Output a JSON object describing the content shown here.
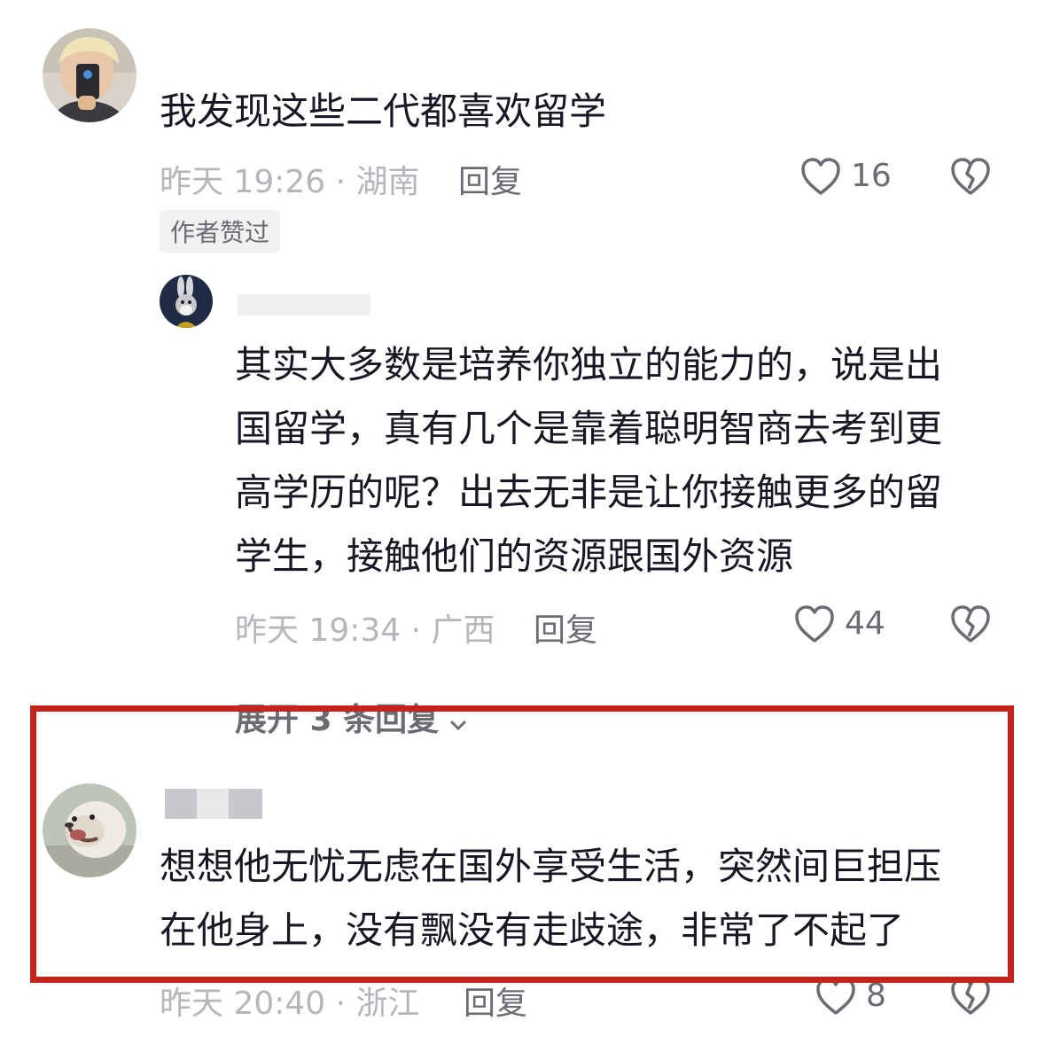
{
  "comments": [
    {
      "avatar": "avatar-young-man-phone",
      "text": "我发现这些二代都喜欢留学",
      "meta": "昨天 19:26 · 湖南",
      "reply_label": "回复",
      "likes": "16",
      "badge": "作者赞过"
    },
    {
      "avatar": "avatar-bugs-bunny",
      "text_lines": [
        "其实大多数是培养你独立的能力的，说是出",
        "国留学，真有几个是靠着聪明智商去考到更",
        "高学历的呢？出去无非是让你接触更多的留",
        "学生，接触他们的资源跟国外资源"
      ],
      "meta": "昨天 19:34 · 广西",
      "reply_label": "回复",
      "likes": "44",
      "expand_label": "展开 3 条回复"
    },
    {
      "avatar": "avatar-bulldog",
      "text_lines": [
        "想想他无忧无虑在国外享受生活，突然间巨担压",
        "在他身上，没有飘没有走歧途，非常了不起了"
      ],
      "meta": "昨天 20:40 · 浙江",
      "reply_label": "回复",
      "likes": "8"
    }
  ],
  "colors": {
    "highlight_border": "#c4241b",
    "text_primary": "#161823",
    "text_meta": "#b5b5bb",
    "text_secondary": "#6b6b73"
  },
  "icons": [
    "heart-outline-icon",
    "broken-heart-icon",
    "chevron-down-icon"
  ]
}
